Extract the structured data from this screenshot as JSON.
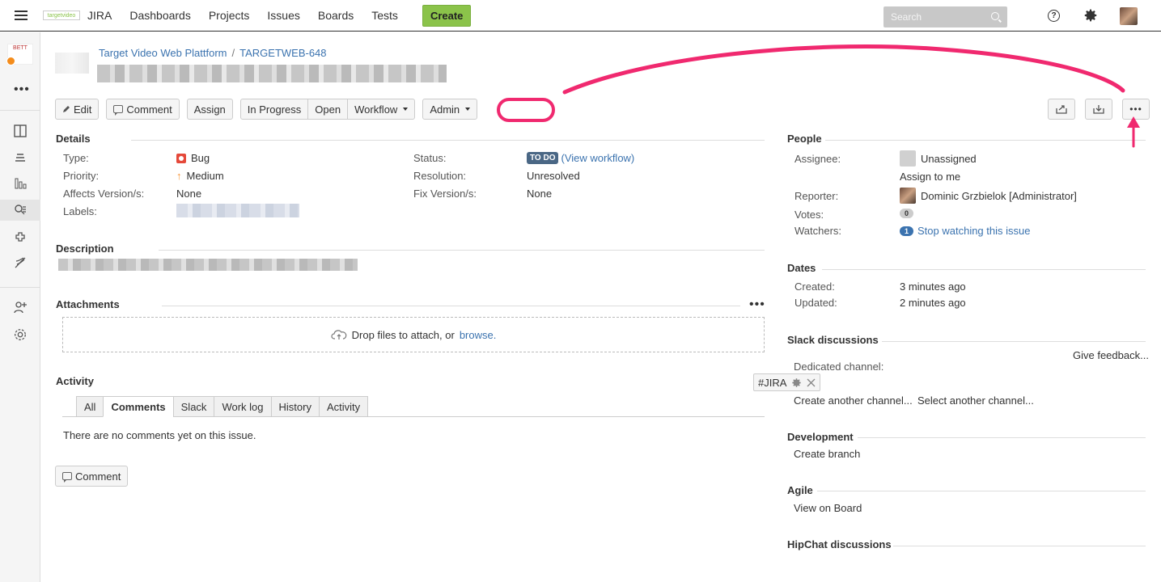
{
  "topnav": {
    "brand_logo_text": "targetvideo",
    "brand_name": "JIRA",
    "items": [
      "Dashboards",
      "Projects",
      "Issues",
      "Boards",
      "Tests"
    ],
    "create_label": "Create",
    "search_placeholder": "Search"
  },
  "sidebar": {
    "logo_text": "BETT",
    "icons": [
      "board-icon",
      "backlog-icon",
      "reports-icon",
      "issues-search-icon",
      "addons-icon",
      "release-icon",
      "add-user-icon",
      "settings-icon"
    ]
  },
  "breadcrumb": {
    "project": "Target Video Web Plattform",
    "separator": "/",
    "issue_key": "TARGETWEB-648"
  },
  "toolbar": {
    "edit": "Edit",
    "comment": "Comment",
    "assign": "Assign",
    "in_progress": "In Progress",
    "open": "Open",
    "workflow": "Workflow",
    "admin": "Admin"
  },
  "details": {
    "heading": "Details",
    "type_label": "Type:",
    "type_value": "Bug",
    "priority_label": "Priority:",
    "priority_value": "Medium",
    "affects_label": "Affects Version/s:",
    "affects_value": "None",
    "labels_label": "Labels:",
    "status_label": "Status:",
    "status_value": "TO DO",
    "view_workflow": "(View workflow)",
    "resolution_label": "Resolution:",
    "resolution_value": "Unresolved",
    "fix_label": "Fix Version/s:",
    "fix_value": "None"
  },
  "description": {
    "heading": "Description"
  },
  "attachments": {
    "heading": "Attachments",
    "drop_text": "Drop files to attach, or",
    "browse": "browse."
  },
  "activity": {
    "heading": "Activity",
    "tabs": [
      "All",
      "Comments",
      "Slack",
      "Work log",
      "History",
      "Activity"
    ],
    "active_tab": "Comments",
    "empty_text": "There are no comments yet on this issue.",
    "comment_button": "Comment"
  },
  "people": {
    "heading": "People",
    "assignee_label": "Assignee:",
    "assignee_value": "Unassigned",
    "assign_to_me": "Assign to me",
    "reporter_label": "Reporter:",
    "reporter_value": "Dominic Grzbielok [Administrator]",
    "votes_label": "Votes:",
    "votes_count": "0",
    "watchers_label": "Watchers:",
    "watchers_count": "1",
    "stop_watching": "Stop watching this issue"
  },
  "dates": {
    "heading": "Dates",
    "created_label": "Created:",
    "created_value": "3 minutes ago",
    "updated_label": "Updated:",
    "updated_value": "2 minutes ago"
  },
  "slack": {
    "heading": "Slack discussions",
    "give_feedback": "Give feedback...",
    "dedicated_label": "Dedicated channel:",
    "channel": "#JIRA",
    "create_another": "Create another channel...",
    "select_another": "Select another channel..."
  },
  "development": {
    "heading": "Development",
    "create_branch": "Create branch"
  },
  "agile": {
    "heading": "Agile",
    "view_on_board": "View on Board"
  },
  "hipchat": {
    "heading": "HipChat discussions"
  },
  "colors": {
    "annotation": "#f0296f",
    "link": "#3b73af",
    "create": "#8bc34a",
    "status": "#4a6785"
  }
}
